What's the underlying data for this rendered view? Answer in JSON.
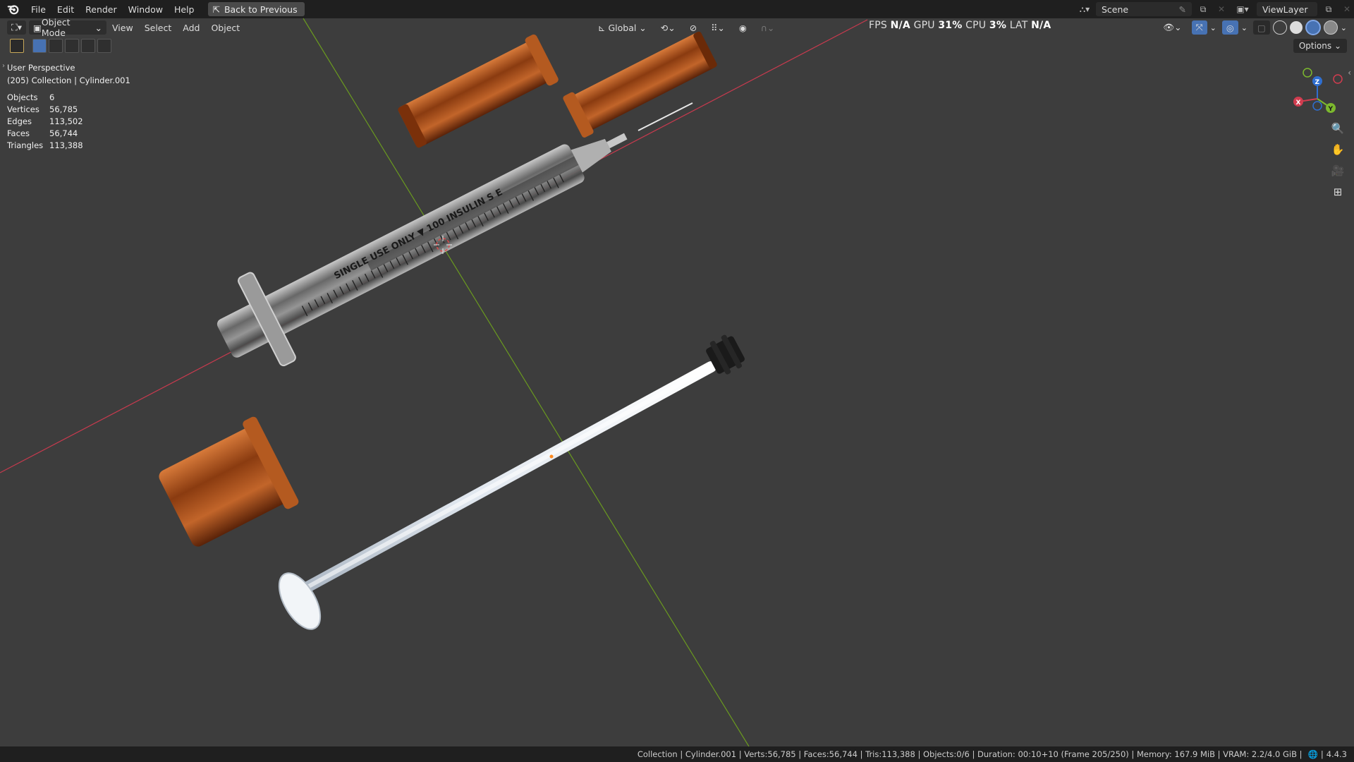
{
  "menubar": {
    "items": [
      "File",
      "Edit",
      "Render",
      "Window",
      "Help"
    ],
    "back_button": "Back to Previous",
    "scene_name": "Scene",
    "view_layer": "ViewLayer"
  },
  "viewport_header": {
    "mode": "Object Mode",
    "menus": [
      "View",
      "Select",
      "Add",
      "Object"
    ],
    "orientation": "Global",
    "perf": {
      "fps_label": "FPS",
      "fps_value": "N/A",
      "gpu_label": "GPU",
      "gpu_value": "31%",
      "cpu_label": "CPU",
      "cpu_value": "3%",
      "lat_label": "LAT",
      "lat_value": "N/A"
    },
    "options": "Options"
  },
  "overlay": {
    "view_name": "User Perspective",
    "collection_info": "(205) Collection | Cylinder.001",
    "stats": [
      {
        "label": "Objects",
        "value": "6"
      },
      {
        "label": "Vertices",
        "value": "56,785"
      },
      {
        "label": "Edges",
        "value": "113,502"
      },
      {
        "label": "Faces",
        "value": "56,744"
      },
      {
        "label": "Triangles",
        "value": "113,388"
      }
    ]
  },
  "syringe_label": "SINGLE USE ONLY ▼ 100 INSULIN S E",
  "gizmo": {
    "x": "X",
    "y": "Y",
    "z": "Z"
  },
  "statusbar": {
    "text": "Collection | Cylinder.001 | Verts:56,785 | Faces:56,744 | Tris:113,388 | Objects:0/6 | Duration: 00:10+10 (Frame 205/250) | Memory: 167.9 MiB | VRAM: 2.2/4.0 GiB |",
    "version": "4.4.3"
  },
  "colors": {
    "x_axis": "#c83a4e",
    "y_axis": "#6a9a1f",
    "amber": "#b0551c",
    "plunger": "#e9eef4"
  }
}
